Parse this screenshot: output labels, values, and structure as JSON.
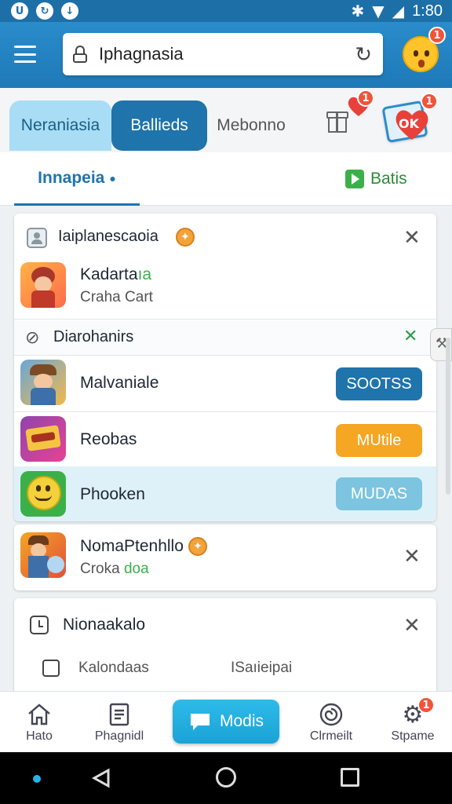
{
  "status_bar": {
    "time": "1:80",
    "left_icons": [
      "u-badge-icon",
      "sync-icon",
      "download-icon"
    ]
  },
  "app_bar": {
    "search_value": "Iphagnasia",
    "avatar_badge": "1"
  },
  "chips": [
    {
      "label": "Neraniasia"
    },
    {
      "label": "Ballieds"
    },
    {
      "label": "Mebonno"
    }
  ],
  "chips_extra": {
    "heart_badge": "1",
    "sticker_badge": "1",
    "sticker_text": "OK"
  },
  "tabs": {
    "left": "Innapeia",
    "right": "Batis"
  },
  "card_a": {
    "header": {
      "title": "Iaiplanescaoia",
      "coin": "✦"
    },
    "featured": {
      "title": "Kadarta",
      "title_accent": "ıa",
      "subtitle": "Craha Cart"
    },
    "section": {
      "title": "Diarohanirs"
    },
    "items": [
      {
        "name": "Malvaniale",
        "button": "SOOTSS",
        "color": "#1f74ab"
      },
      {
        "name": "Reobas",
        "button": "MUtile",
        "color": "#f5a623"
      },
      {
        "name": "Phooken",
        "button": "MUDAS",
        "color": "#7cc4e0"
      }
    ]
  },
  "card_b": {
    "title": "NomaPtenhllo",
    "sub_prefix": "Croka",
    "sub_accent": "doa"
  },
  "card_c": {
    "title": "Nionaakalo",
    "col1": "Kalondaas",
    "col2": "ISaıieipai"
  },
  "bottom_nav": [
    {
      "label": "Hato"
    },
    {
      "label": "Phagnidl"
    },
    {
      "label": "Modis"
    },
    {
      "label": "Clrmeilt"
    },
    {
      "label": "Stpame",
      "badge": "1"
    }
  ],
  "colors": {
    "primary": "#1f74ab",
    "accent_green": "#3bb049",
    "orange": "#f5a623"
  }
}
